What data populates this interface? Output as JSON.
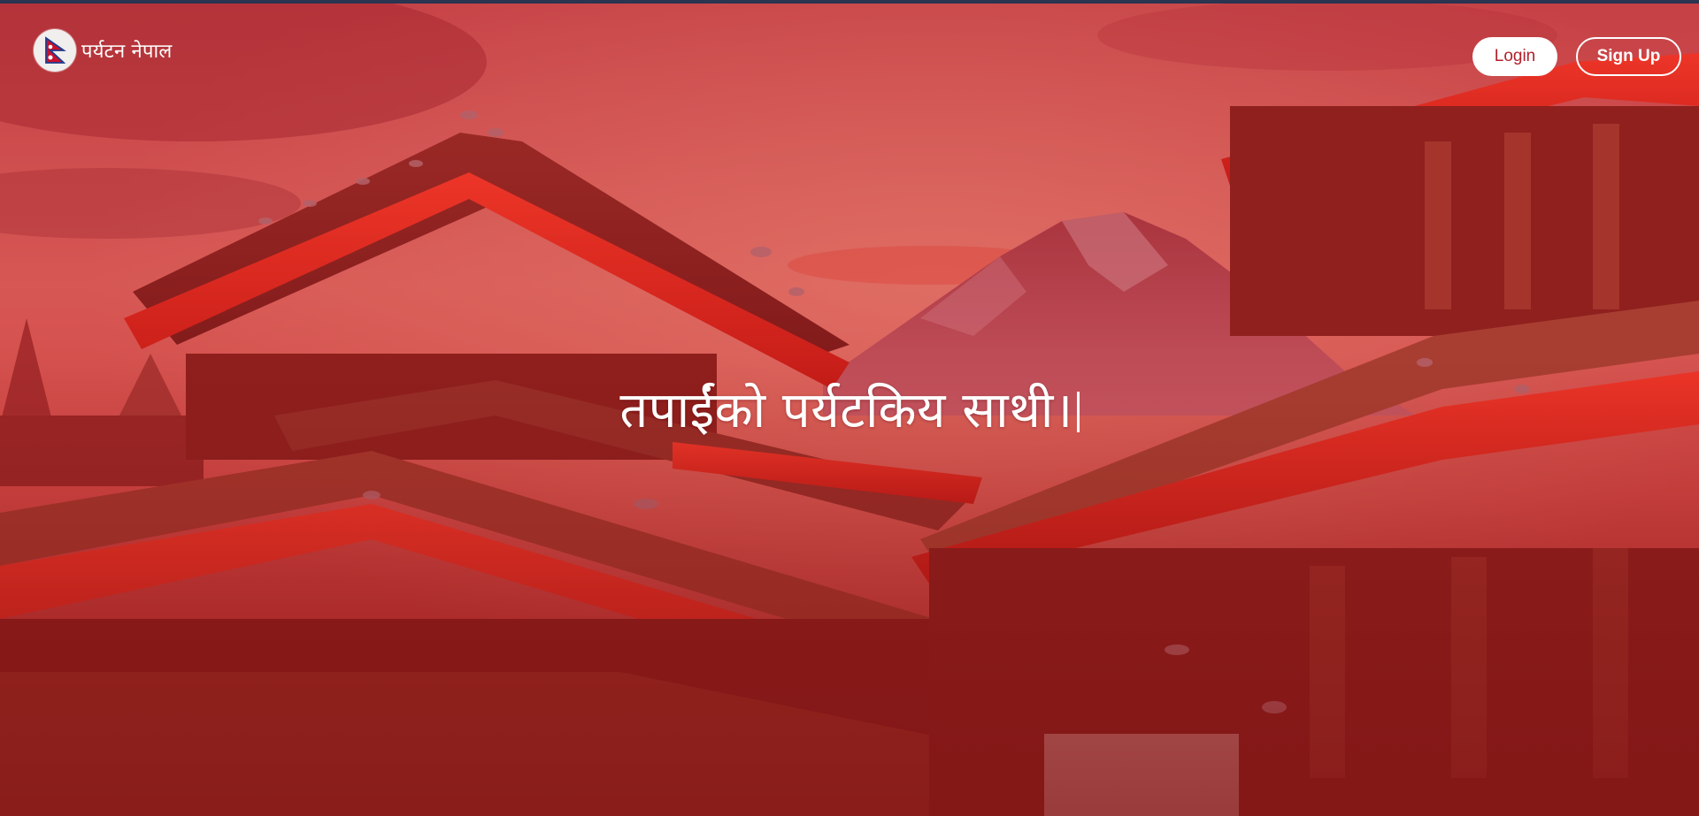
{
  "brand": {
    "name": "पर्यटन नेपाल",
    "logo_icon": "nepal-flag-icon"
  },
  "nav": {
    "login_label": "Login",
    "signup_label": "Sign Up"
  },
  "hero": {
    "title": "तपाईंको पर्यटकिय साथी।"
  },
  "colors": {
    "overlay": "#c0262e",
    "login_text": "#b21f2b",
    "top_strip": "#2b3450"
  }
}
